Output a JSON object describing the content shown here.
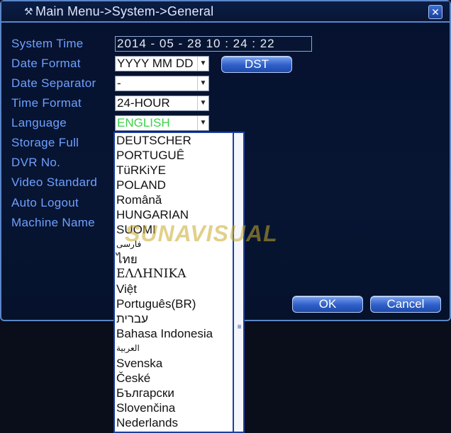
{
  "window": {
    "title": "Main Menu->System->General",
    "close_label": "✕"
  },
  "fields": {
    "system_time": {
      "label": "System Time",
      "value": "2014 - 05 - 28   10 : 24 : 22"
    },
    "date_format": {
      "label": "Date Format",
      "value": "YYYY MM DD"
    },
    "date_separator": {
      "label": "Date Separator",
      "value": "-"
    },
    "time_format": {
      "label": "Time Format",
      "value": "24-HOUR"
    },
    "language": {
      "label": "Language",
      "value": "ENGLISH"
    },
    "storage_full": {
      "label": "Storage Full"
    },
    "dvr_no": {
      "label": "DVR No."
    },
    "video_standard": {
      "label": "Video Standard"
    },
    "auto_logout": {
      "label": "Auto Logout"
    },
    "machine_name": {
      "label": "Machine Name"
    }
  },
  "buttons": {
    "dst": "DST",
    "ok": "OK",
    "cancel": "Cancel"
  },
  "language_dropdown": {
    "options": [
      "DEUTSCHER",
      "PORTUGUÊ",
      "TüRKiYE",
      "POLAND",
      "Română",
      "HUNGARIAN",
      "SUOMI",
      "فارسی",
      "ไทย",
      "ΕΛΛΗΝΙΚΑ",
      "Việt",
      "Português(BR)",
      "עברית",
      "Bahasa Indonesia",
      "العربية",
      "Svenska",
      "České",
      "Български",
      "Slovenčina",
      "Nederlands"
    ]
  },
  "watermark": "SUNAVISUAL",
  "colors": {
    "label": "#6fa0ff",
    "border": "#5a86c8",
    "background": "#071533",
    "language_selected": "#3ad04a"
  },
  "icons": {
    "title": "menu-tool-icon",
    "select_arrow": "triangle-down-icon",
    "scroll": "scroll-grip-icon"
  }
}
